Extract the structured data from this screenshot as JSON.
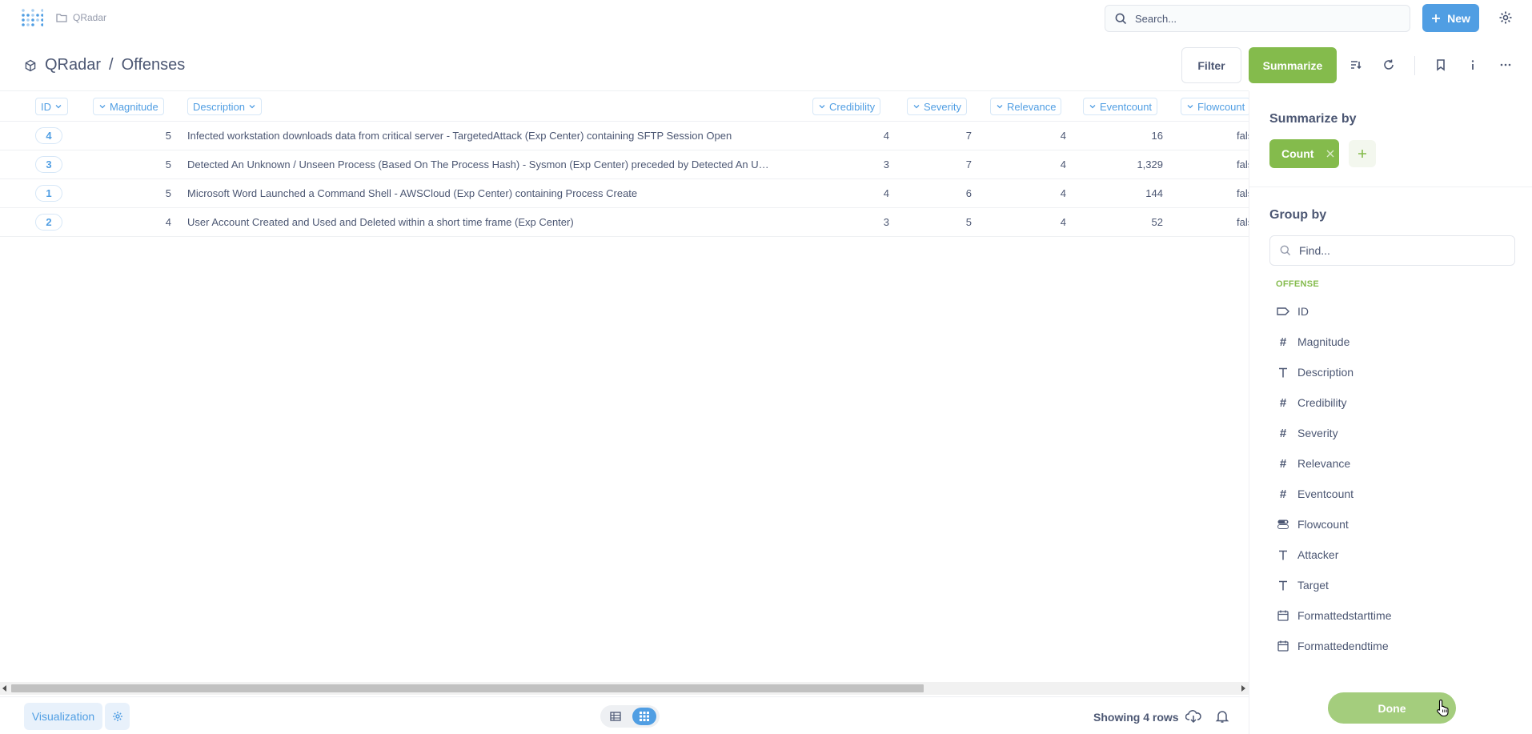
{
  "topbar": {
    "breadcrumb": "QRadar",
    "search_placeholder": "Search...",
    "new_label": "New"
  },
  "header": {
    "collection": "QRadar",
    "separator": "/",
    "table": "Offenses",
    "filter_label": "Filter",
    "summarize_label": "Summarize"
  },
  "table": {
    "columns": [
      "ID",
      "Magnitude",
      "Description",
      "Credibility",
      "Severity",
      "Relevance",
      "Eventcount",
      "Flowcount"
    ],
    "rows": [
      {
        "id": "4",
        "magnitude": "5",
        "description": "Infected workstation downloads data from critical server - TargetedAttack (Exp Center) containing SFTP Session Open",
        "credibility": "4",
        "severity": "7",
        "relevance": "4",
        "eventcount": "16",
        "flowcount": "fals"
      },
      {
        "id": "3",
        "magnitude": "5",
        "description": "Detected An Unknown / Unseen Process (Based On The Process Hash) - Sysmon (Exp Center) preceded by Detected An Unknown …",
        "credibility": "3",
        "severity": "7",
        "relevance": "4",
        "eventcount": "1,329",
        "flowcount": "fals"
      },
      {
        "id": "1",
        "magnitude": "5",
        "description": "Microsoft Word Launched a Command Shell - AWSCloud (Exp Center) containing Process Create",
        "credibility": "4",
        "severity": "6",
        "relevance": "4",
        "eventcount": "144",
        "flowcount": "fals"
      },
      {
        "id": "2",
        "magnitude": "4",
        "description": "User Account Created and Used and Deleted within a short time frame (Exp Center)",
        "credibility": "3",
        "severity": "5",
        "relevance": "4",
        "eventcount": "52",
        "flowcount": "fals"
      }
    ]
  },
  "footer": {
    "visualization_label": "Visualization",
    "rows_label": "Showing 4 rows"
  },
  "panel": {
    "summarize_by_title": "Summarize by",
    "metric_label": "Count",
    "group_by_title": "Group by",
    "find_placeholder": "Find...",
    "section_label": "OFFENSE",
    "fields": [
      {
        "label": "ID",
        "icon": "tag-icon"
      },
      {
        "label": "Magnitude",
        "icon": "hash-icon"
      },
      {
        "label": "Description",
        "icon": "text-icon"
      },
      {
        "label": "Credibility",
        "icon": "hash-icon"
      },
      {
        "label": "Severity",
        "icon": "hash-icon"
      },
      {
        "label": "Relevance",
        "icon": "hash-icon"
      },
      {
        "label": "Eventcount",
        "icon": "hash-icon"
      },
      {
        "label": "Flowcount",
        "icon": "toggle-icon"
      },
      {
        "label": "Attacker",
        "icon": "text-icon"
      },
      {
        "label": "Target",
        "icon": "text-icon"
      },
      {
        "label": "Formattedstarttime",
        "icon": "calendar-icon"
      },
      {
        "label": "Formattedendtime",
        "icon": "calendar-icon"
      }
    ],
    "done_label": "Done"
  },
  "colors": {
    "brand_blue": "#509ee3",
    "summarize_green": "#84bb4c",
    "text": "#4c5773"
  }
}
